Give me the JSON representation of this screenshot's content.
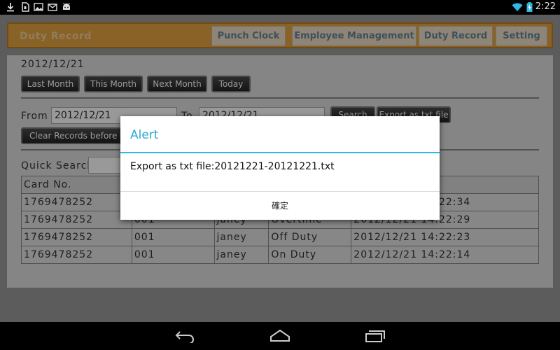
{
  "status_bar": {
    "time": "2:22",
    "icons": [
      "download-icon",
      "sd-card-icon",
      "gallery-icon",
      "gmail-icon",
      "android-icon",
      "wifi-icon",
      "battery-charging-icon"
    ]
  },
  "header": {
    "title": "Duty Record",
    "nav": [
      {
        "label": "Punch Clock"
      },
      {
        "label": "Employee Management"
      },
      {
        "label": "Duty Record"
      },
      {
        "label": "Setting"
      }
    ]
  },
  "panel": {
    "current_date": "2012/12/21",
    "period_buttons": [
      "Last Month",
      "This Month",
      "Next Month",
      "Today"
    ],
    "from_label": "From",
    "from_value": "2012/12/21",
    "to_label": "To",
    "to_value": "2012/12/21",
    "search_label": "Search",
    "export_label": "Export as txt file",
    "clear_label": "Clear Records before 6 m",
    "quick_search_label": "Quick Search"
  },
  "table": {
    "header": [
      "Card No.",
      "",
      "",
      "",
      ""
    ],
    "rows": [
      [
        "1769478252",
        "",
        "",
        "",
        "2012/12/21 14:22:34"
      ],
      [
        "1769478252",
        "001",
        "janey",
        "Overtime",
        "2012/12/21 14:22:29"
      ],
      [
        "1769478252",
        "001",
        "janey",
        "Off Duty",
        "2012/12/21 14:22:23"
      ],
      [
        "1769478252",
        "001",
        "janey",
        "On Duty",
        "2012/12/21 14:22:14"
      ]
    ]
  },
  "dialog": {
    "title": "Alert",
    "message": "Export as txt file:20121221-20121221.txt",
    "ok_label": "確定"
  },
  "nav_bar": {
    "icons": [
      "back-icon",
      "home-icon",
      "recent-apps-icon"
    ]
  },
  "colors": {
    "header_orange": "#e5a441",
    "nav_text_blue": "#3e7bb7",
    "dialog_accent": "#33b5e5"
  }
}
